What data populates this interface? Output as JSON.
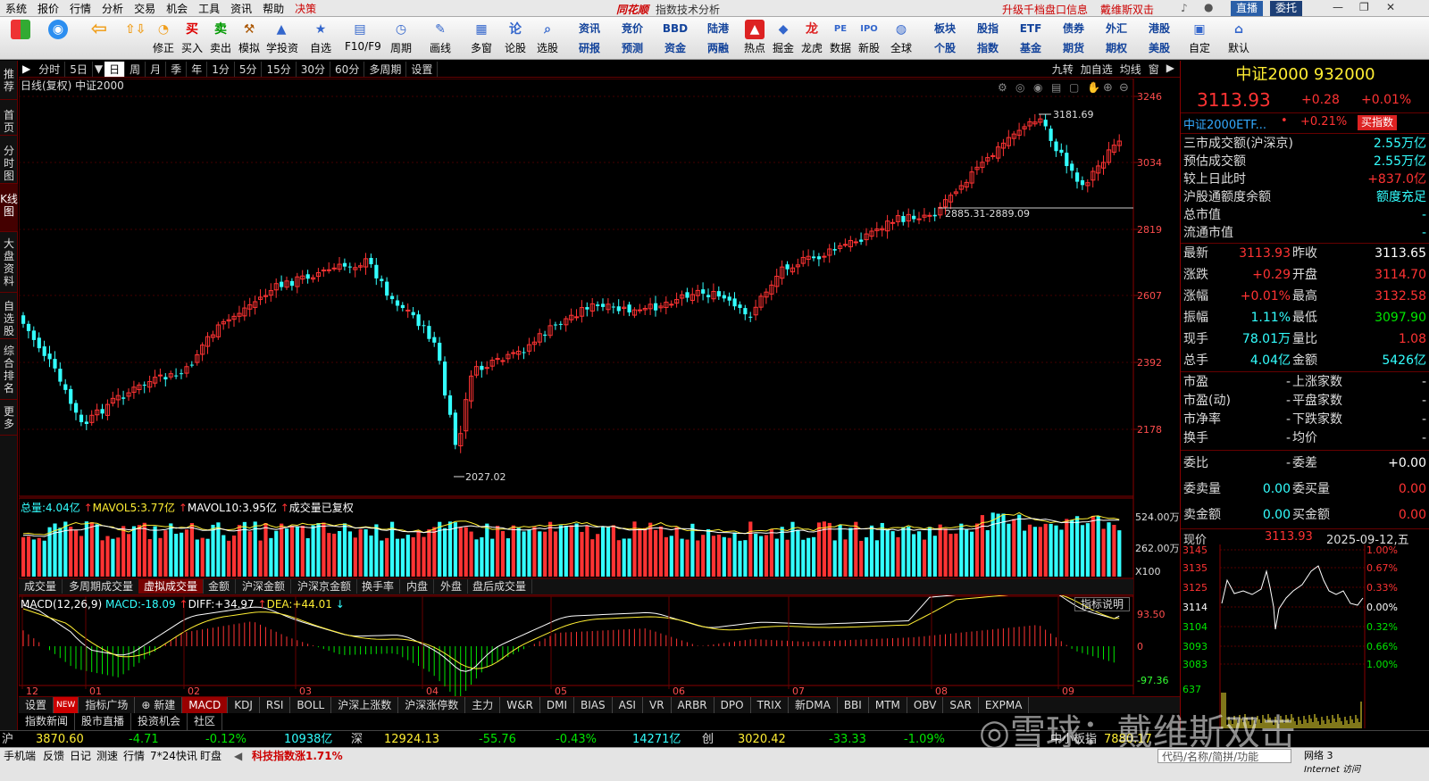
{
  "menu": {
    "items": [
      "系统",
      "报价",
      "行情",
      "分析",
      "交易",
      "机会",
      "工具",
      "资讯",
      "帮助",
      "决策"
    ],
    "app_title": "同花顺",
    "window_title": "指数技术分析",
    "right_links": [
      "升级千档盘口信息",
      "戴维斯双击"
    ],
    "live": "直播",
    "commission": "委托"
  },
  "toolbar": {
    "buttons": [
      "修正",
      "买入",
      "卖出",
      "模拟",
      "学投资",
      "自选",
      "F10/F9",
      "周期",
      "画线",
      "多窗",
      "论股",
      "选股",
      "热点",
      "掘金",
      "龙虎",
      "数据",
      "新股",
      "全球",
      "自定",
      "默认"
    ],
    "grid_top": [
      "资讯",
      "竞价",
      "BBD",
      "陆港",
      "板块",
      "股指",
      "ETF",
      "债券",
      "外汇",
      "港股"
    ],
    "grid_bottom": [
      "研报",
      "预测",
      "资金",
      "两融",
      "个股",
      "指数",
      "基金",
      "期货",
      "期权",
      "美股"
    ]
  },
  "left_tabs": [
    "推荐",
    "首页",
    "分时图",
    "K线图",
    "大盘资料",
    "自选股",
    "综合排名",
    "更多"
  ],
  "period": {
    "items": [
      "分时",
      "5日",
      "日",
      "周",
      "月",
      "季",
      "年",
      "1分",
      "5分",
      "15分",
      "30分",
      "60分",
      "多周期",
      "设置"
    ],
    "selected": "日",
    "right": [
      "九转",
      "加自选",
      "均线",
      "窗"
    ]
  },
  "chart": {
    "header": "日线(复权)  中证2000",
    "price_axis": [
      "3246",
      "3034",
      "2819",
      "2607",
      "2392",
      "2178"
    ],
    "high_label": "3181.69",
    "low_label": "2027.02",
    "gap_label": "2885.31-2889.09",
    "volume": {
      "total_label": "总量:",
      "total": "4.04亿",
      "mavol5_label": "MAVOL5:",
      "mavol5": "3.77亿",
      "mavol10_label": "MAVOL10:",
      "mavol10": "3.95亿",
      "note": "成交量已复权",
      "axis": [
        "524.00万",
        "262.00万",
        "X100"
      ]
    },
    "vol_tabs": [
      "成交量",
      "多周期成交量",
      "虚拟成交量",
      "金额",
      "沪深金额",
      "沪深京金额",
      "换手率",
      "内盘",
      "外盘",
      "盘后成交量"
    ],
    "vol_tab_selected": "虚拟成交量",
    "macd": {
      "title": "MACD(12,26,9)",
      "macd_label": "MACD:",
      "macd": "-18.09",
      "diff_label": "DIFF:",
      "diff": "+34.97",
      "dea_label": "DEA:",
      "dea": "+44.01",
      "help": "指标说明",
      "axis": [
        "93.50",
        "0",
        "-97.36"
      ]
    },
    "months": [
      "12",
      "01",
      "02",
      "03",
      "04",
      "05",
      "06",
      "07",
      "08",
      "09"
    ]
  },
  "bottom_tabs": [
    "设置",
    "NEW",
    "指标广场",
    "新建",
    "MACD",
    "KDJ",
    "RSI",
    "BOLL",
    "沪深上涨数",
    "沪深涨停数",
    "主力",
    "W&R",
    "DMI",
    "BIAS",
    "ASI",
    "VR",
    "ARBR",
    "DPO",
    "TRIX",
    "新DMA",
    "BBI",
    "MTM",
    "OBV",
    "SAR",
    "EXPMA"
  ],
  "news_tabs": [
    "指数新闻",
    "股市直播",
    "投资机会",
    "社区"
  ],
  "ticker": {
    "sh_label": "沪",
    "sh": "3870.60",
    "sh_chg": "-4.71",
    "sh_pct": "-0.12%",
    "sh_amt": "10938亿",
    "sz_label": "深",
    "sz": "12924.13",
    "sz_chg": "-55.76",
    "sz_pct": "-0.43%",
    "sz_amt": "14271亿",
    "cy_label": "创",
    "cy": "3020.42",
    "cy_chg": "-33.33",
    "cy_pct": "-1.09%",
    "zx_label": "中小板指",
    "zx": "7880.17"
  },
  "status": {
    "items": [
      "手机端",
      "反馈",
      "日记",
      "测速",
      "行情",
      "7*24快讯",
      "盯盘"
    ],
    "hot": "科技指数涨1.71%",
    "search": "代码/名称/简拼/功能",
    "net": "网络 3",
    "net_en": "Internet 访问"
  },
  "watermark": "雪球：戴维斯双击",
  "right": {
    "title": "中证2000 932000",
    "price": "3113.93",
    "chg": "+0.28",
    "pct": "+0.01%",
    "etf": "中证2000ETF...",
    "etf_pct": "+0.21%",
    "buy_btn": "买指数",
    "market_rows": [
      {
        "k": "三市成交额(沪深京)",
        "v": "2.55万亿"
      },
      {
        "k": "预估成交额",
        "v": "2.55万亿"
      },
      {
        "k": "较上日此时",
        "v": "+837.0亿"
      },
      {
        "k": "沪股通额度余额",
        "v": "额度充足"
      },
      {
        "k": "总市值",
        "v": "-"
      },
      {
        "k": "流通市值",
        "v": "-"
      }
    ],
    "quote": [
      {
        "k1": "最新",
        "v1": "3113.93",
        "k2": "昨收",
        "v2": "3113.65"
      },
      {
        "k1": "涨跌",
        "v1": "+0.29",
        "k2": "开盘",
        "v2": "3114.70"
      },
      {
        "k1": "涨幅",
        "v1": "+0.01%",
        "k2": "最高",
        "v2": "3132.58"
      },
      {
        "k1": "振幅",
        "v1": "1.11%",
        "k2": "最低",
        "v2": "3097.90"
      },
      {
        "k1": "现手",
        "v1": "78.01万",
        "k2": "量比",
        "v2": "1.08"
      },
      {
        "k1": "总手",
        "v1": "4.04亿",
        "k2": "金额",
        "v2": "5426亿"
      }
    ],
    "breadth": [
      {
        "k1": "市盈",
        "v1": "-",
        "k2": "上涨家数",
        "v2": "-"
      },
      {
        "k1": "市盈(动)",
        "v1": "-",
        "k2": "平盘家数",
        "v2": "-"
      },
      {
        "k1": "市净率",
        "v1": "-",
        "k2": "下跌家数",
        "v2": "-"
      },
      {
        "k1": "换手",
        "v1": "-",
        "k2": "均价",
        "v2": "-"
      }
    ],
    "order": [
      {
        "k1": "委比",
        "v1": "-",
        "k2": "委差",
        "v2": "+0.00"
      },
      {
        "k1": "委卖量",
        "v1": "0.00",
        "k2": "委买量",
        "v2": "0.00"
      },
      {
        "k1": "卖金额",
        "v1": "0.00",
        "k2": "买金额",
        "v2": "0.00"
      }
    ],
    "mini": {
      "label": "现价",
      "price": "3113.93",
      "date": "2025-09-12,五",
      "left_axis": [
        "3145",
        "3135",
        "3125",
        "3114",
        "3104",
        "3093",
        "3083",
        "637"
      ],
      "right_axis": [
        "1.00%",
        "0.67%",
        "0.33%",
        "0.00%",
        "0.32%",
        "0.66%",
        "1.00%"
      ]
    }
  }
}
